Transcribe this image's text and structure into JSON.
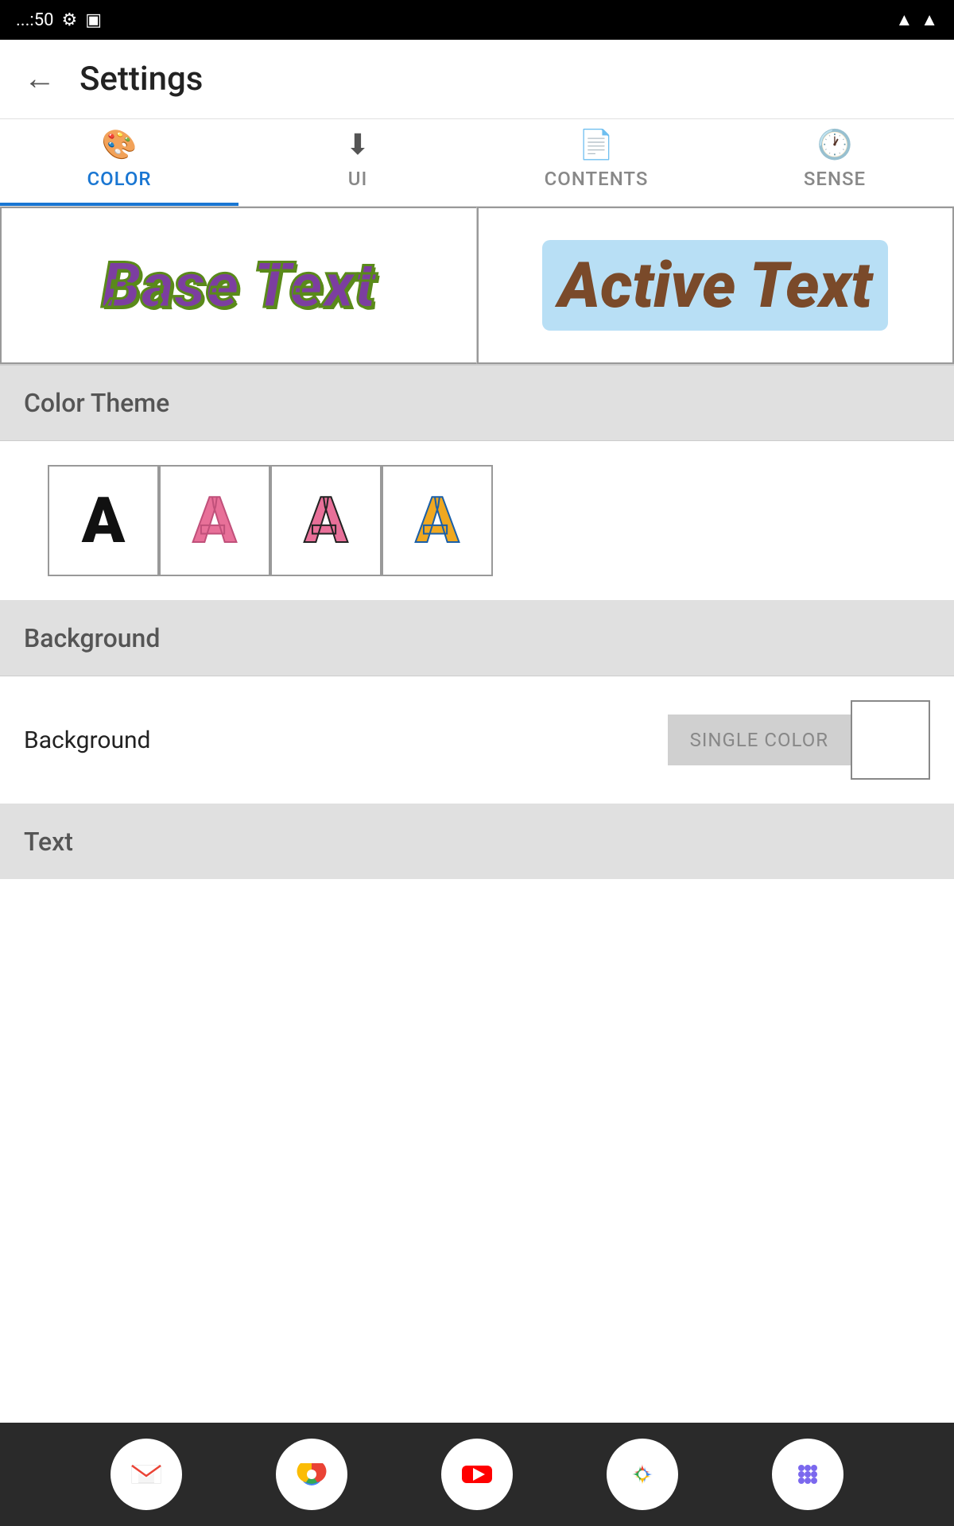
{
  "statusBar": {
    "time": "...:50",
    "icons": [
      "settings-icon",
      "sim-icon",
      "wifi-icon",
      "signal-icon"
    ]
  },
  "header": {
    "title": "Settings",
    "backLabel": "←"
  },
  "tabs": [
    {
      "id": "color",
      "label": "COLOR",
      "icon": "🎨",
      "active": true
    },
    {
      "id": "ui",
      "label": "UI",
      "icon": "⬇",
      "active": false
    },
    {
      "id": "contents",
      "label": "CONTENTS",
      "icon": "📄",
      "active": false
    },
    {
      "id": "sense",
      "label": "SENSE",
      "icon": "🕐",
      "active": false
    }
  ],
  "preview": {
    "baseText": "Base Text",
    "activeText": "Active Text"
  },
  "colorTheme": {
    "sectionLabel": "Color Theme",
    "options": [
      {
        "letter": "A",
        "style": "black"
      },
      {
        "letter": "A",
        "style": "pink-outline"
      },
      {
        "letter": "A",
        "style": "pink-black"
      },
      {
        "letter": "A",
        "style": "gold-blue"
      }
    ]
  },
  "background": {
    "sectionLabel": "Background",
    "rowLabel": "Background",
    "singleColorLabel": "SINGLE COLOR"
  },
  "text": {
    "sectionLabel": "Text"
  },
  "bottomNav": [
    {
      "id": "gmail",
      "icon": "M",
      "label": "gmail-icon"
    },
    {
      "id": "chrome",
      "icon": "⬤",
      "label": "chrome-icon"
    },
    {
      "id": "youtube",
      "icon": "▶",
      "label": "youtube-icon"
    },
    {
      "id": "photos",
      "icon": "✿",
      "label": "photos-icon"
    },
    {
      "id": "apps",
      "icon": "⋯",
      "label": "apps-icon"
    }
  ]
}
